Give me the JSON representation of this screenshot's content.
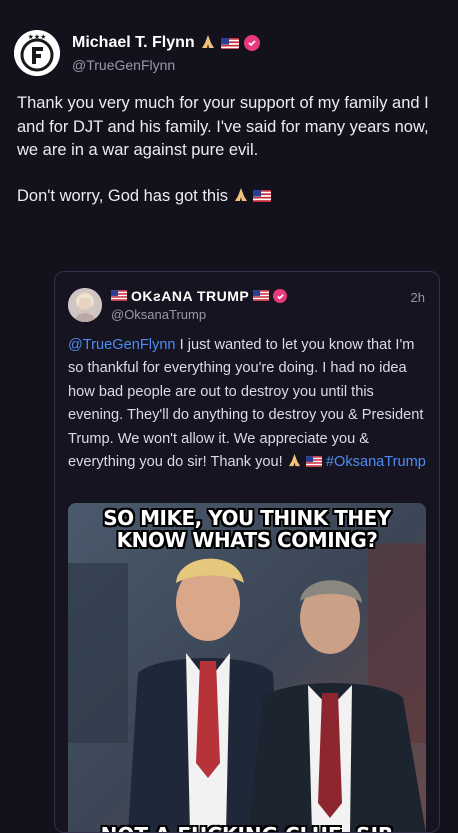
{
  "post": {
    "author": {
      "display_name": "Michael T. Flynn",
      "name_emojis": [
        "folded-hands",
        "us-flag"
      ],
      "handle": "@TrueGenFlynn",
      "verified": true,
      "verified_color": "#e8397a"
    },
    "body": {
      "paragraph1": "Thank you very much for your support of my family and I and for DJT and his family. I've said for many years now, we are in a war against pure evil.",
      "paragraph2": "Don't worry, God has got this"
    }
  },
  "quote": {
    "author": {
      "display_name": "OKƨANA TRUMP",
      "handle": "@OksanaTrump",
      "verified": true
    },
    "time": "2h",
    "mention": "@TrueGenFlynn",
    "text": " I just wanted to let you know that I'm so thankful for everything you're doing. I had no idea how bad people are out to destroy you until this evening. They'll do anything to destroy you & President Trump. We won't allow it. We appreciate you & everything you do sir! Thank you! ",
    "hashtag": "#OksanaTrump",
    "meme": {
      "caption_top": "SO MIKE, YOU THINK THEY KNOW WHATS COMING?",
      "caption_bottom": "NOT A FUCKING CLUE, SIR"
    }
  },
  "colors": {
    "background": "#13111c",
    "link": "#4f8cf0",
    "muted": "#9a97ab"
  }
}
